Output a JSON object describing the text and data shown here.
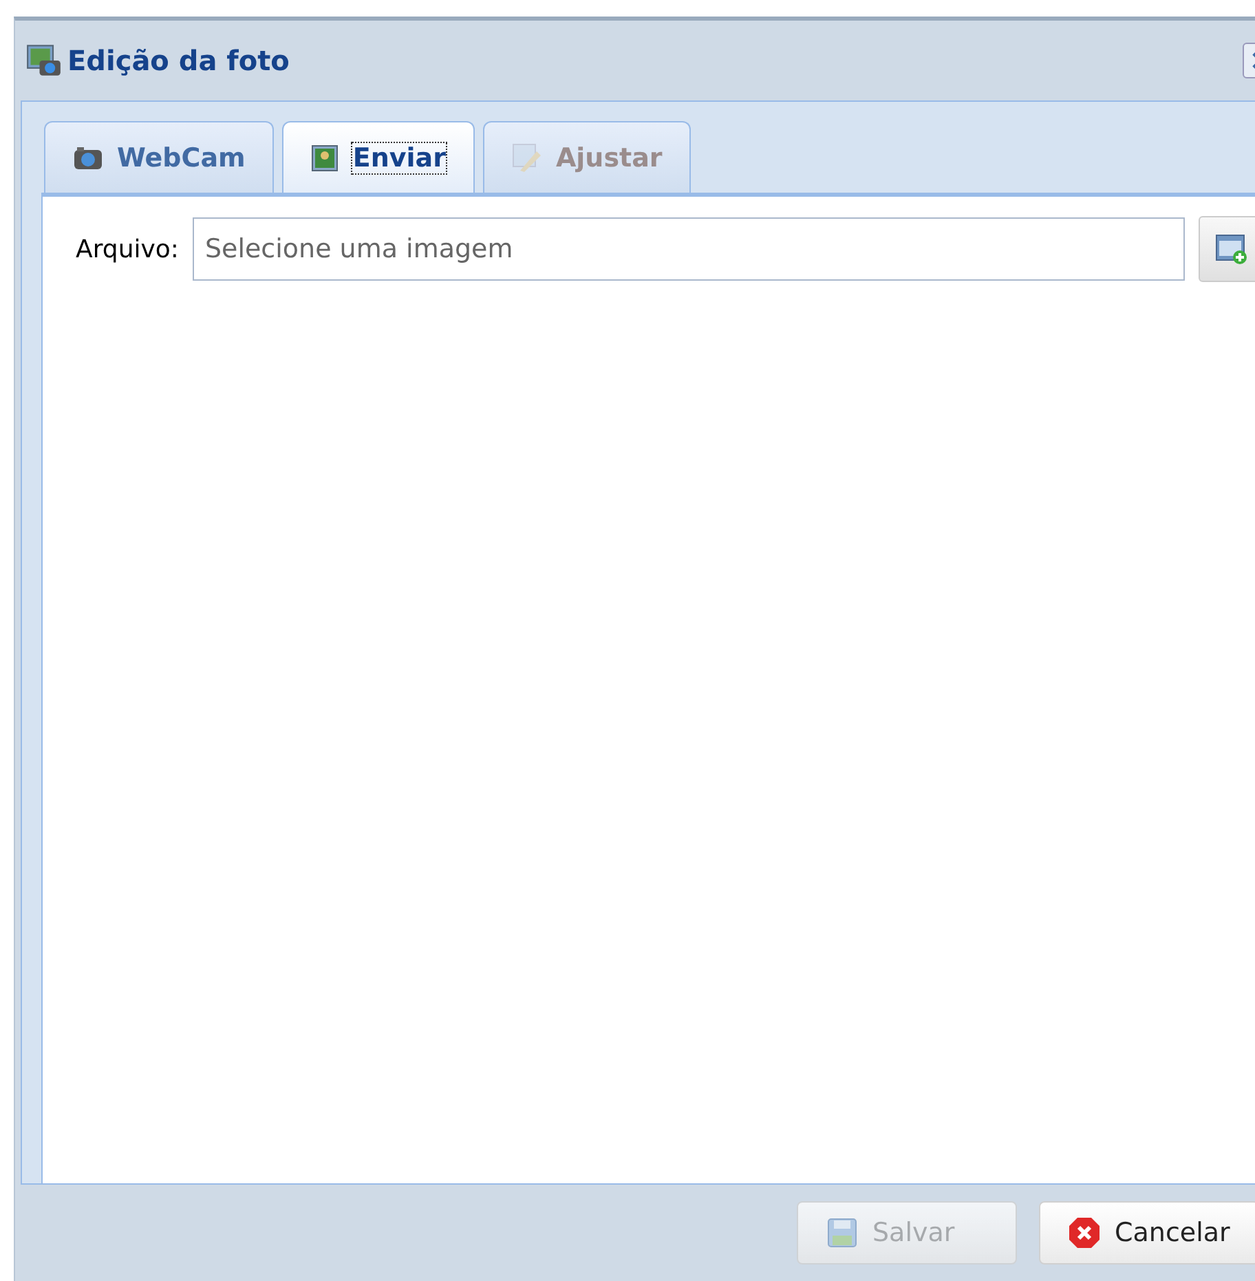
{
  "window": {
    "title": "Edição da foto"
  },
  "tabs": [
    {
      "label": "WebCam",
      "kind": "camera",
      "selected": false,
      "disabled": false
    },
    {
      "label": "Enviar",
      "kind": "picture",
      "selected": true,
      "disabled": false
    },
    {
      "label": "Ajustar",
      "kind": "edit",
      "selected": false,
      "disabled": true
    }
  ],
  "file_field": {
    "label": "Arquivo:",
    "placeholder": "Selecione uma imagem"
  },
  "buttons": [
    {
      "label": "Salvar",
      "kind": "save",
      "disabled": true
    },
    {
      "label": "Cancelar",
      "kind": "cancel",
      "disabled": false
    }
  ]
}
